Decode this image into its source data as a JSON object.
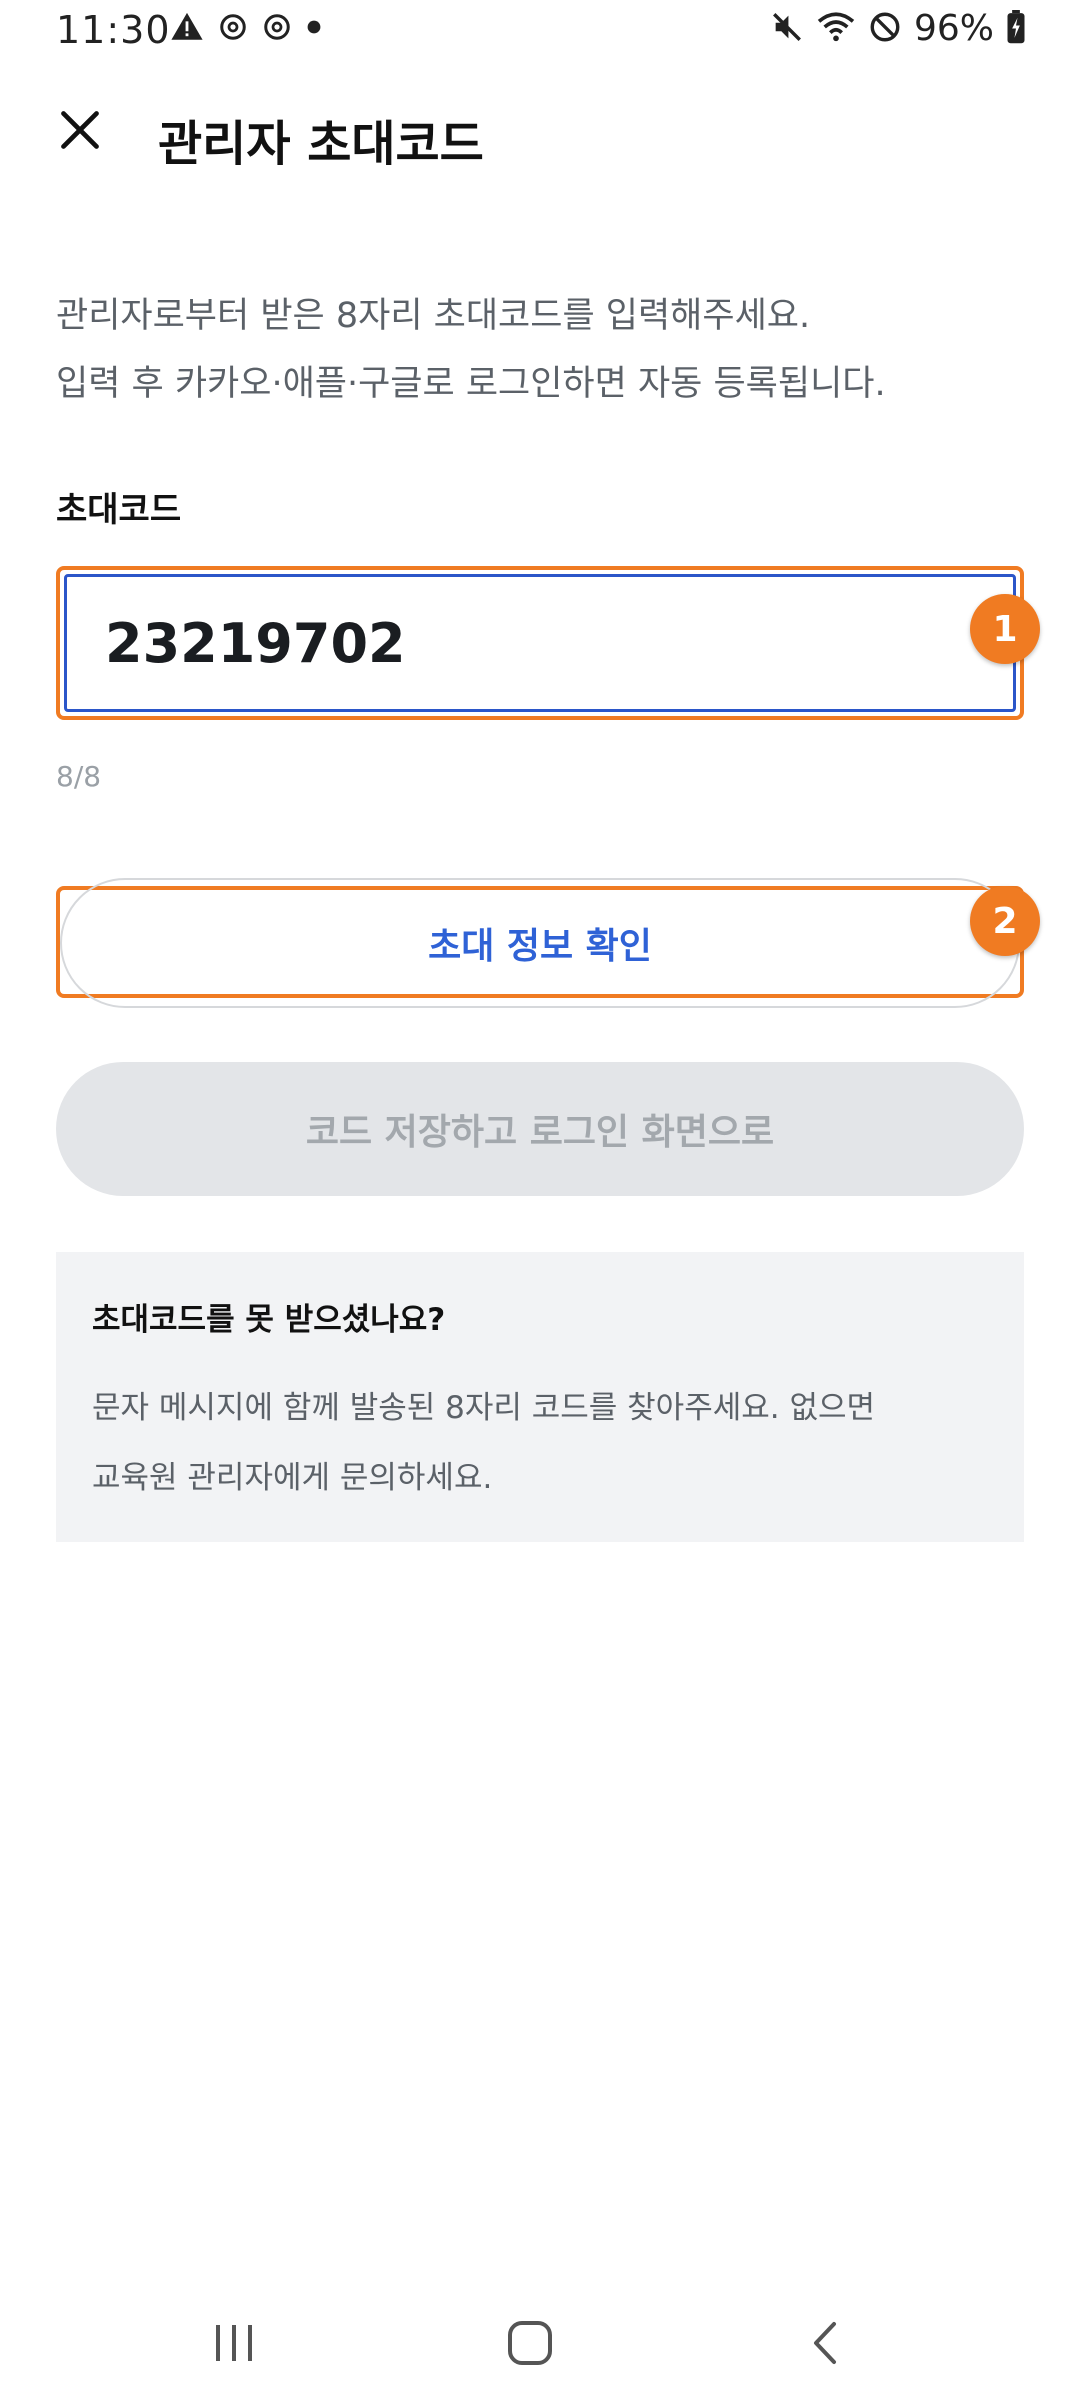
{
  "status_bar": {
    "time": "11:30",
    "battery": "96%",
    "left_icons": [
      "warning-icon",
      "threads-icon",
      "threads-icon",
      "dot-icon"
    ],
    "right_icons": [
      "mute-icon",
      "wifi-icon",
      "dnd-icon",
      "battery-charging-icon"
    ]
  },
  "header": {
    "title": "관리자 초대코드",
    "close_icon": "close-icon"
  },
  "intro": {
    "line1": "관리자로부터 받은 8자리 초대코드를 입력해주세요.",
    "line2": "입력 후 카카오·애플·구글로 로그인하면 자동 등록됩니다."
  },
  "form": {
    "label": "초대코드",
    "value": "23219702",
    "char_count": "8/8"
  },
  "badges": [
    "1",
    "2"
  ],
  "buttons": {
    "confirm": "초대 정보 확인",
    "save": "코드 저장하고 로그인 화면으로"
  },
  "help": {
    "title": "초대코드를 못 받으셨나요?",
    "line1": "문자 메시지에 함께 발송된 8자리 코드를 찾아주세요. 없으면",
    "line2": "교육원 관리자에게 문의하세요."
  },
  "nav": {
    "icons": [
      "recent-apps-icon",
      "home-icon",
      "back-icon"
    ]
  },
  "colors": {
    "highlight": "#f07b22",
    "accent_blue": "#2f62d6",
    "disabled_bg": "#e3e5e8",
    "help_bg": "#f2f3f5"
  }
}
